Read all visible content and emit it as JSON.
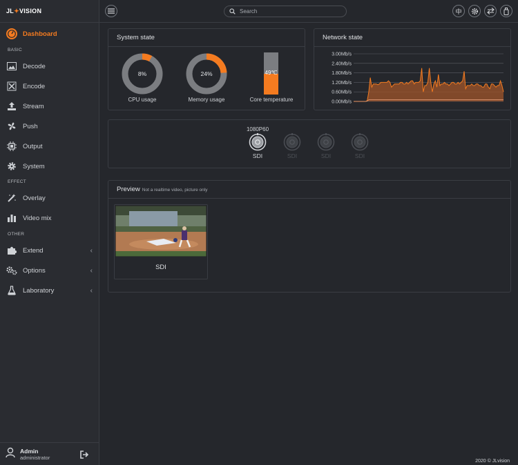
{
  "brand": {
    "pre": "JL",
    "mid": "✦",
    "post": "VISION"
  },
  "sidebar": {
    "items": [
      {
        "label": "Dashboard",
        "icon": "dashboard-icon"
      },
      {
        "label": "Decode",
        "icon": "image-icon"
      },
      {
        "label": "Encode",
        "icon": "encode-icon"
      },
      {
        "label": "Stream",
        "icon": "upload-icon"
      },
      {
        "label": "Push",
        "icon": "fan-icon"
      },
      {
        "label": "Output",
        "icon": "chip-icon"
      },
      {
        "label": "System",
        "icon": "gear-icon"
      },
      {
        "label": "Overlay",
        "icon": "magic-wand-icon"
      },
      {
        "label": "Video mix",
        "icon": "bar-chart-icon"
      },
      {
        "label": "Extend",
        "icon": "puzzle-icon"
      },
      {
        "label": "Options",
        "icon": "gears-icon"
      },
      {
        "label": "Laboratory",
        "icon": "flask-icon"
      }
    ],
    "sections": {
      "basic": "BASIC",
      "effect": "EFFECT",
      "other": "OTHER"
    }
  },
  "user": {
    "name": "Admin",
    "role": "administrator"
  },
  "topbar": {
    "search_placeholder": "Search",
    "lang": "中"
  },
  "system_state": {
    "title": "System state",
    "cpu": {
      "label": "CPU usage",
      "value_text": "8%",
      "value": 0.08
    },
    "memory": {
      "label": "Memory usage",
      "value_text": "24%",
      "value": 0.24
    },
    "temperature": {
      "label": "Core temperature",
      "value_text": "49℃",
      "value": 0.49
    }
  },
  "network_state": {
    "title": "Network state",
    "chart_data": {
      "type": "area",
      "ylim": [
        0,
        3.0
      ],
      "yticks": [
        "3.00Mb/s",
        "2.40Mb/s",
        "1.80Mb/s",
        "1.20Mb/s",
        "0.60Mb/s",
        "0.00Mb/s"
      ],
      "series": [
        {
          "values": [
            0,
            0,
            0,
            0,
            0,
            0,
            0,
            0,
            0,
            0.05,
            0.6,
            1.5,
            0.9,
            1.1,
            1.1,
            1.1,
            1.05,
            1.1,
            1.2,
            1.2,
            1.2,
            1.2,
            1.2,
            1.3,
            1.2,
            0.9,
            1.0,
            1.1,
            1.1,
            1.1,
            1.1,
            1.2,
            1.2,
            1.1,
            1.1,
            1.2,
            1.1,
            1.2,
            1.3,
            1.3,
            1.1,
            1.2,
            1.2,
            1.2,
            1.3,
            2.1,
            0.6,
            1.0,
            1.0,
            1.2,
            2.1,
            1.2,
            0.6,
            1.1,
            1.3,
            0.9,
            1.7,
            1.0,
            1.1,
            1.1,
            1.2,
            1.1,
            1.1,
            1.0,
            1.1,
            1.2,
            1.2,
            1.1,
            1.1,
            1.2,
            1.1,
            1.2,
            1.3,
            1.9,
            0.8,
            1.0,
            1.0,
            1.0,
            1.1,
            1.0,
            1.0,
            1.1,
            1.1,
            1.0,
            1.0,
            0.9,
            0.9,
            1.1,
            1.1,
            0.9,
            0.8,
            1.1,
            1.1,
            1.0,
            0.9,
            1.0,
            1.0,
            1.3,
            1.0,
            0.6
          ]
        },
        {
          "values": [
            0,
            0,
            0,
            0,
            0,
            0,
            0,
            0,
            0,
            0.02,
            0.1,
            0.1,
            0.1,
            0.1,
            0.1,
            0.1,
            0.1,
            0.1,
            0.1,
            0.1,
            0.1,
            0.1,
            0.1,
            0.1,
            0.1,
            0.1,
            0.1,
            0.1,
            0.1,
            0.1,
            0.1,
            0.1,
            0.1,
            0.1,
            0.1,
            0.1,
            0.1,
            0.1,
            0.1,
            0.1,
            0.1,
            0.1,
            0.1,
            0.1,
            0.1,
            0.1,
            0.1,
            0.1,
            0.1,
            0.1,
            0.1,
            0.1,
            0.1,
            0.1,
            0.1,
            0.1,
            0.1,
            0.1,
            0.1,
            0.1,
            0.1,
            0.1,
            0.1,
            0.1,
            0.1,
            0.1,
            0.1,
            0.1,
            0.1,
            0.1,
            0.1,
            0.1,
            0.1,
            0.1,
            0.1,
            0.1,
            0.1,
            0.1,
            0.1,
            0.1,
            0.1,
            0.1,
            0.1,
            0.1,
            0.1,
            0.1,
            0.1,
            0.1,
            0.1,
            0.1,
            0.1,
            0.1,
            0.1,
            0.1,
            0.1,
            0.1,
            0.1,
            0.1,
            0.1,
            0.1
          ]
        }
      ]
    }
  },
  "channels": [
    {
      "label": "SDI",
      "format": "1080P60",
      "active": true
    },
    {
      "label": "SDI",
      "format": "",
      "active": false
    },
    {
      "label": "SDI",
      "format": "",
      "active": false
    },
    {
      "label": "SDI",
      "format": "",
      "active": false
    }
  ],
  "preview": {
    "title": "Preview",
    "subtitle": "Not a realtime video, picture only",
    "card_label": "SDI"
  },
  "footer": "2020 © JLvision",
  "colors": {
    "accent": "#f47b20",
    "track": "#7b7d81",
    "bg": "#25272c"
  }
}
